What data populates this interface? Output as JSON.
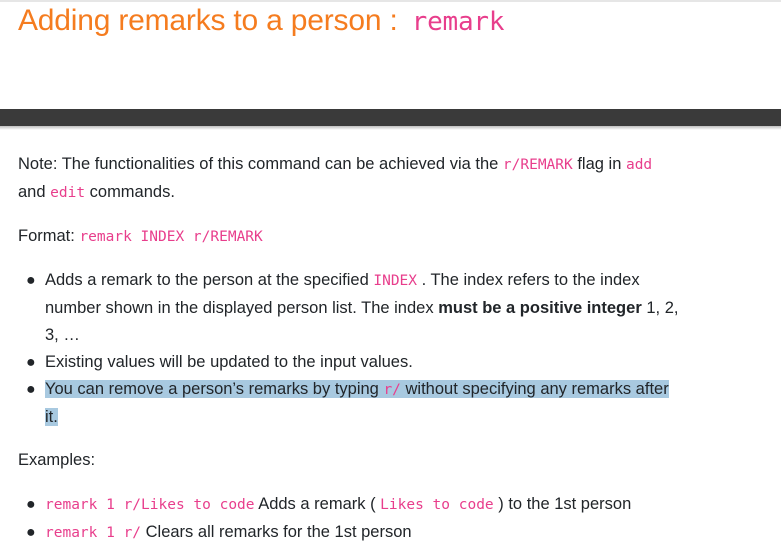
{
  "heading": {
    "text": "Adding remarks to a person :",
    "command": "remark"
  },
  "note": {
    "line1_text": "Note: The functionalities of this command can be achieved via the",
    "flag": "r/REMARK",
    "line1_mid": "flag in",
    "cmd_add": "add",
    "line2_start": "and",
    "cmd_edit": "edit",
    "line2_end": "commands."
  },
  "format": {
    "label": "Format:",
    "syntax": "remark INDEX r/REMARK"
  },
  "bullets": {
    "b1_a": "Adds a remark to the person at the specified",
    "b1_code": "INDEX",
    "b1_b": ". The index refers to the index",
    "b1_c": "number shown in the displayed person list. The index",
    "b1_bold": "must be a positive integer",
    "b1_d": "1, 2,",
    "b1_e": "3, …",
    "b2": "Existing values will be updated to the input values.",
    "b3_a": "You can remove a person’s remarks by typing",
    "b3_code": "r/",
    "b3_b": "without specifying any remarks after",
    "b3_c": "it."
  },
  "examples": {
    "label": "Examples:",
    "e1_code": "remark 1 r/Likes to code",
    "e1_a": "Adds a remark (",
    "e1_value": "Likes to code",
    "e1_b": ") to the 1st person",
    "e2_code": "remark 1 r/",
    "e2_a": "Clears all remarks for the 1st person"
  },
  "colors": {
    "heading": "#f57c1f",
    "code": "#e83e8c",
    "highlight": "#a8c9e0",
    "band": "#3a3a3a"
  }
}
